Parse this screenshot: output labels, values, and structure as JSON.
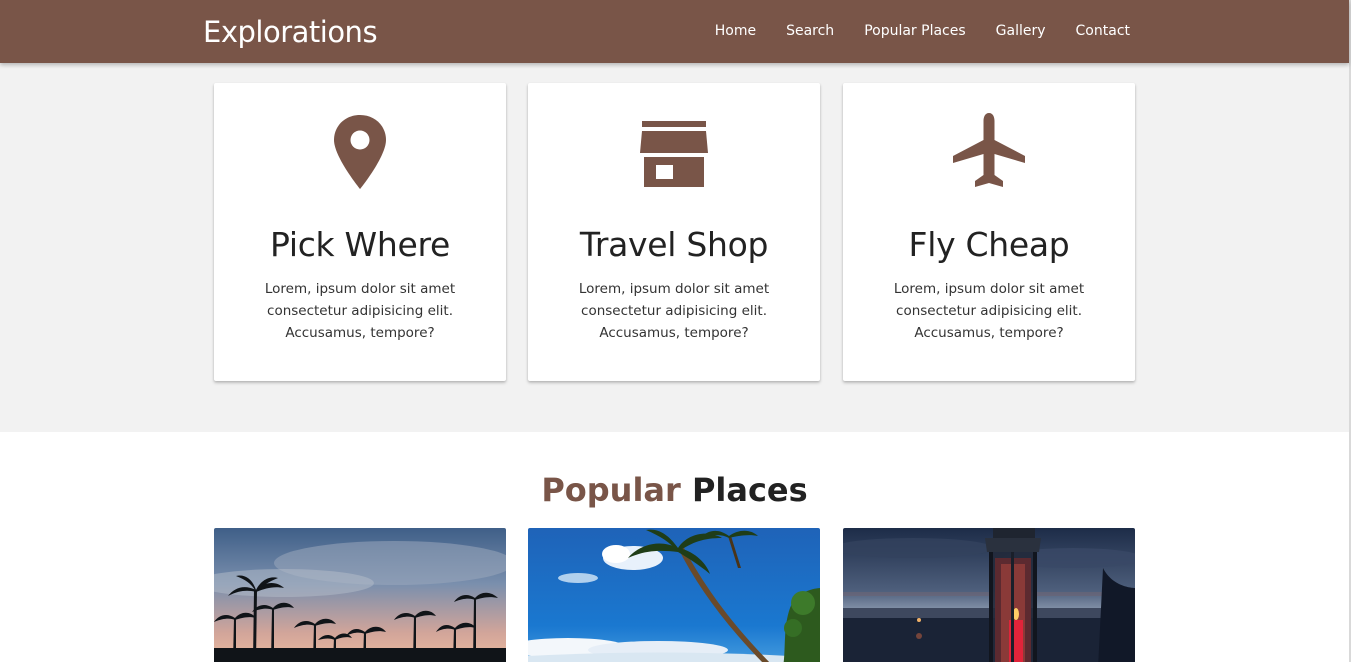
{
  "brand": "Explorations",
  "nav": {
    "items": [
      "Home",
      "Search",
      "Popular Places",
      "Gallery",
      "Contact"
    ]
  },
  "features": [
    {
      "icon": "map-marker-icon",
      "title": "Pick Where",
      "text": "Lorem, ipsum dolor sit amet consectetur adipisicing elit. Accusamus, tempore?"
    },
    {
      "icon": "store-icon",
      "title": "Travel Shop",
      "text": "Lorem, ipsum dolor sit amet consectetur adipisicing elit. Accusamus, tempore?"
    },
    {
      "icon": "airplane-icon",
      "title": "Fly Cheap",
      "text": "Lorem, ipsum dolor sit amet consectetur adipisicing elit. Accusamus, tempore?"
    }
  ],
  "popular": {
    "heading_accent": "Popular",
    "heading_rest": "Places",
    "images": [
      "palm-trees-sunset-photo",
      "palm-tree-beach-photo",
      "lantern-by-lake-photo"
    ]
  },
  "colors": {
    "brand": "#795548",
    "background": "#f2f2f2",
    "card": "#ffffff"
  }
}
